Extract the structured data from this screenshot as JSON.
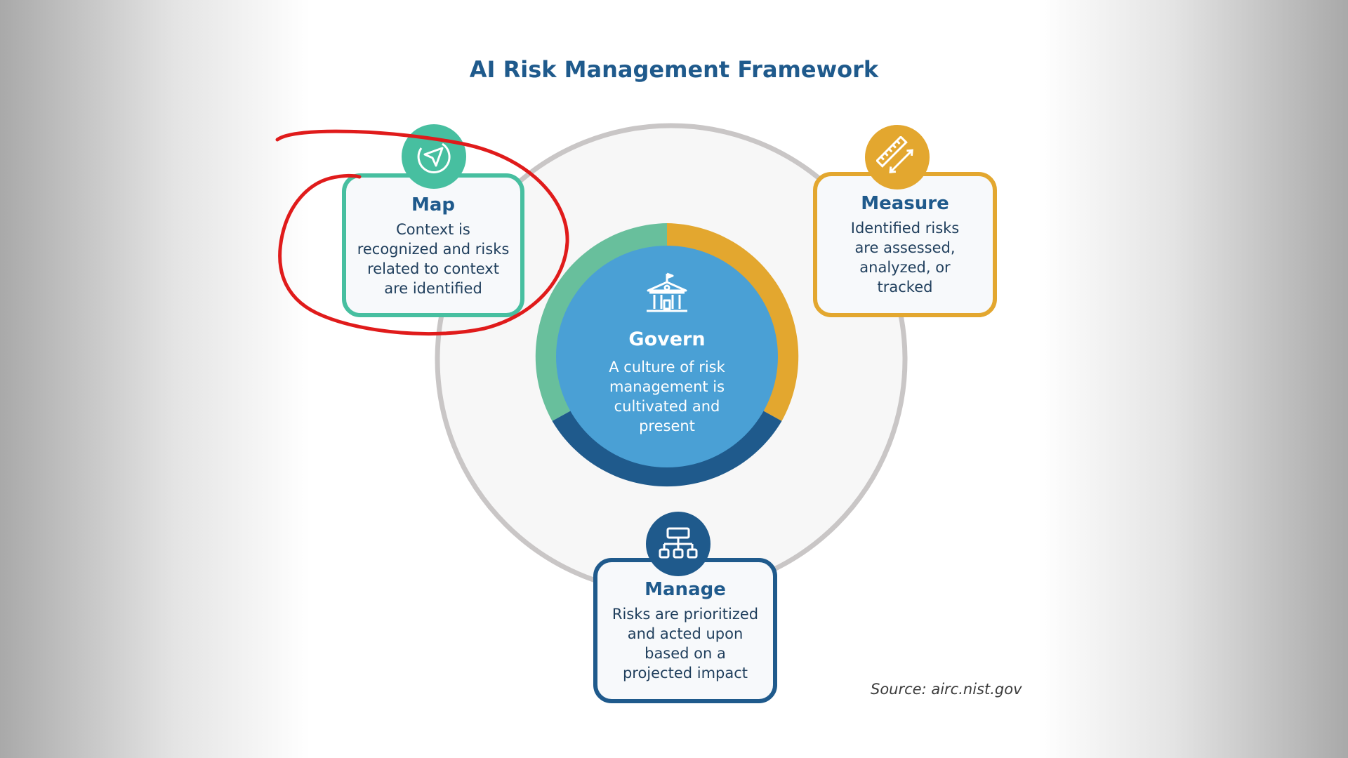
{
  "title": "AI Risk Management Framework",
  "source": "Source: airc.nist.gov",
  "govern": {
    "heading": "Govern",
    "description": "A culture of risk\nmanagement is\ncultivated and\npresent",
    "icon": "building-icon"
  },
  "map": {
    "heading": "Map",
    "description": "Context is\nrecognized and risks\nrelated to context\nare identified",
    "icon": "navigation-icon"
  },
  "measure": {
    "heading": "Measure",
    "description": "Identified risks\nare assessed,\nanalyzed, or\ntracked",
    "icon": "ruler-icon"
  },
  "manage": {
    "heading": "Manage",
    "description": "Risks are prioritized\nand acted upon\nbased on a\nprojected impact",
    "icon": "hierarchy-icon"
  },
  "colors": {
    "title": "#1f5a8c",
    "map": "#47bfa0",
    "measure": "#e3a72f",
    "manage": "#1f5a8c",
    "govern_center": "#4aa0d5",
    "annotation": "#e01b1b",
    "outer_ring": "#c9c6c6"
  }
}
